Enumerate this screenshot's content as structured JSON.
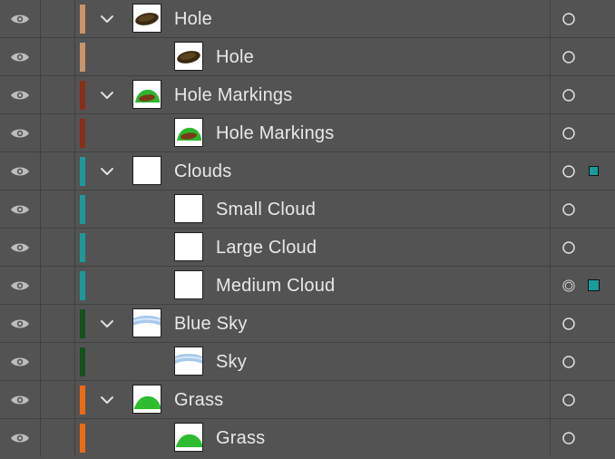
{
  "panel": {
    "title": ""
  },
  "colors": {
    "tan": "#c9946a",
    "brown_red": "#8a2e15",
    "teal": "#1a9b9b",
    "dark_green": "#12521c",
    "orange": "#f06a12"
  },
  "rows": [
    {
      "label": "Hole",
      "level": 0,
      "expanded": true,
      "color": "#c9946a",
      "thumb": "hole",
      "selected": false
    },
    {
      "label": "Hole",
      "level": 1,
      "expanded": false,
      "color": "#c9946a",
      "thumb": "hole",
      "selected": false
    },
    {
      "label": "Hole Markings",
      "level": 0,
      "expanded": true,
      "color": "#8a2e15",
      "thumb": "markings",
      "selected": false
    },
    {
      "label": "Hole Markings",
      "level": 1,
      "expanded": false,
      "color": "#8a2e15",
      "thumb": "markings",
      "selected": false
    },
    {
      "label": "Clouds",
      "level": 0,
      "expanded": true,
      "color": "#1a9b9b",
      "thumb": "blank",
      "selected": "small"
    },
    {
      "label": "Small Cloud",
      "level": 1,
      "expanded": false,
      "color": "#1a9b9b",
      "thumb": "blank",
      "selected": false
    },
    {
      "label": "Large Cloud",
      "level": 1,
      "expanded": false,
      "color": "#1a9b9b",
      "thumb": "blank",
      "selected": false
    },
    {
      "label": "Medium Cloud",
      "level": 1,
      "expanded": false,
      "color": "#1a9b9b",
      "thumb": "blank",
      "selected": "big"
    },
    {
      "label": "Blue Sky",
      "level": 0,
      "expanded": true,
      "color": "#12521c",
      "thumb": "sky",
      "selected": false
    },
    {
      "label": "Sky",
      "level": 1,
      "expanded": false,
      "color": "#12521c",
      "thumb": "sky",
      "selected": false
    },
    {
      "label": "Grass",
      "level": 0,
      "expanded": true,
      "color": "#f06a12",
      "thumb": "grass",
      "selected": false
    },
    {
      "label": "Grass",
      "level": 1,
      "expanded": false,
      "color": "#f06a12",
      "thumb": "grass",
      "selected": false
    }
  ],
  "icons": {
    "visibility": "eye-icon",
    "expand": "chevron-down-icon",
    "target": "target-circle-icon",
    "targeted": "target-ring-icon"
  }
}
